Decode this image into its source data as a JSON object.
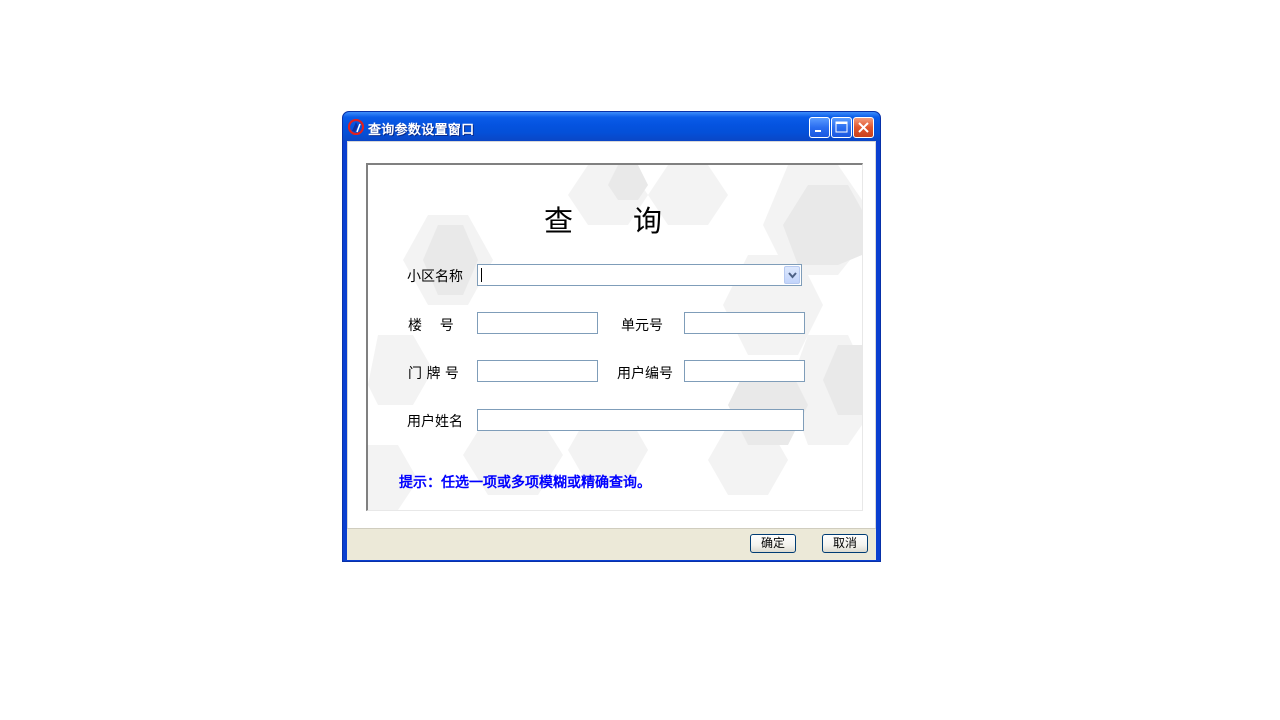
{
  "window": {
    "title": "查询参数设置窗口"
  },
  "form": {
    "heading": "查询",
    "community_label": "小区名称",
    "community_value": "",
    "building_label": "楼    号",
    "building_value": "",
    "unit_label": "单元号",
    "unit_value": "",
    "door_label": "门 牌 号",
    "door_value": "",
    "user_no_label": "用户编号",
    "user_no_value": "",
    "user_name_label": "用户姓名",
    "user_name_value": "",
    "hint": "提示：任选一项或多项模糊或精确查询。"
  },
  "buttons": {
    "ok_label": "确定",
    "cancel_label": "取消"
  },
  "icons": {
    "app": "app-logo-icon",
    "minimize": "minimize-icon",
    "maximize": "maximize-icon",
    "close": "close-icon",
    "dropdown": "chevron-down-icon"
  },
  "colors": {
    "titlebar": "#0553e0",
    "hint_text": "#0000ff",
    "bottombar": "#ece9d8"
  }
}
